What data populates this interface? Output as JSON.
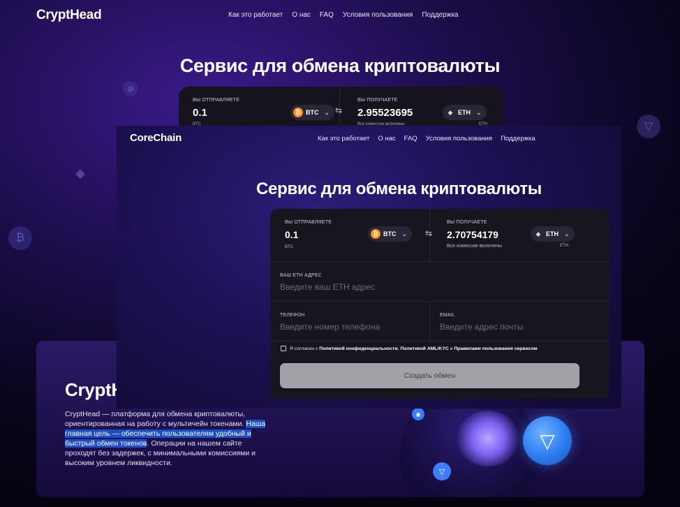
{
  "back": {
    "logo": "CryptHead",
    "nav": [
      "Как это работает",
      "О нас",
      "FAQ",
      "Условия пользования",
      "Поддержка"
    ],
    "hero_title": "Сервис для обмена криптовалюты",
    "widget": {
      "send_label": "ВЫ ОТПРАВЛЯЕТЕ",
      "send_amount": "0.1",
      "send_coin": "BTC",
      "send_coin_tag": "BTC",
      "receive_label": "ВЫ ПОЛУЧАЕТЕ",
      "receive_amount": "2.95523695",
      "receive_coin": "ETH",
      "receive_fee_note": "Все комиссии включены",
      "receive_coin_tag": "ETH"
    },
    "about": {
      "title": "CryptH",
      "text_before": "CryptHead — платформа для обмена криптовалюты, ориентированная на работу с мультичейн токенами. ",
      "text_highlight": "Наша главная цель — обеспечить пользователям удобный и быстрый обмен токенов",
      "text_after": ". Операции на нашем сайте проходят без задержек, с минимальными комиссиями и высоким уровнем ликвидности."
    }
  },
  "front": {
    "logo": "CoreChain",
    "nav": [
      "Как это работает",
      "О нас",
      "FAQ",
      "Условия пользования",
      "Поддержка"
    ],
    "hero_title": "Сервис для обмена криптовалюты",
    "widget": {
      "send_label": "ВЫ ОТПРАВЛЯЕТЕ",
      "send_amount": "0.1",
      "send_coin": "BTC",
      "send_coin_tag": "BTC",
      "receive_label": "ВЫ ПОЛУЧАЕТЕ",
      "receive_amount": "2.70754179",
      "receive_fee_note": "Все комиссии включены",
      "receive_coin": "ETH",
      "receive_coin_tag": "ETH",
      "address_label": "ВАШ ETH АДРЕС",
      "address_placeholder": "Введите ваш ETH адрес",
      "phone_label": "ТЕЛЕФОН",
      "phone_placeholder": "Введите номер телефона",
      "email_label": "EMAIL",
      "email_placeholder": "Введите адрес почты",
      "consent_prefix": "Я согласен с ",
      "consent_privacy": "Политикой конфиденциальности",
      "consent_sep1": ", ",
      "consent_aml": "Политикой AML/KYC",
      "consent_and": " и ",
      "consent_rules": "Правилами пользования сервисом",
      "submit_label": "Создать обмен"
    }
  },
  "colors": {
    "btc": "#f7931a",
    "ton": "#2b7cf0",
    "highlight": "#1d4fc4"
  },
  "icons": {
    "swap": "swap-arrows-icon",
    "chevron": "chevron-down-icon",
    "btc": "bitcoin-icon",
    "eth": "ethereum-icon",
    "ton": "ton-icon"
  }
}
